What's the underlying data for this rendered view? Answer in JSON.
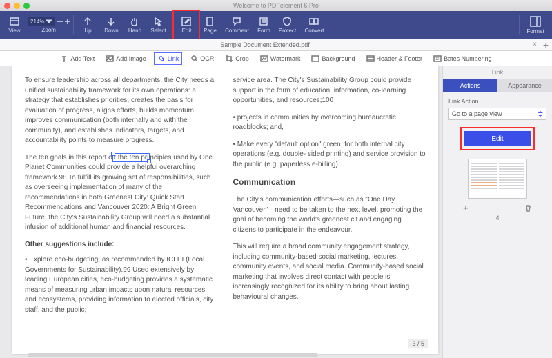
{
  "window": {
    "title": "Welcome to PDFelement 6 Pro"
  },
  "toolbar": {
    "view": "View",
    "zoom": "Zoom",
    "zoom_value": "214%",
    "up": "Up",
    "down": "Down",
    "hand": "Hand",
    "select": "Select",
    "edit": "Edit",
    "page": "Page",
    "comment": "Comment",
    "form": "Form",
    "protect": "Protect",
    "convert": "Convert",
    "format": "Format"
  },
  "tabs": {
    "doc": "Sample Document Extended.pdf",
    "close": "×",
    "plus": "+"
  },
  "subbar": {
    "add_text": "Add Text",
    "add_image": "Add Image",
    "link": "Link",
    "ocr": "OCR",
    "crop": "Crop",
    "watermark": "Watermark",
    "background": "Background",
    "header_footer": "Header & Footer",
    "bates": "Bates Numbering"
  },
  "doc": {
    "left": {
      "p1": "To ensure leadership across all departments, the City needs a unified sustainability framework for its own operations: a strategy that establishes priorities, creates the basis for evaluation of progress, aligns efforts, builds momentum, improves communication (both internally and with the community), and establishes indicators, targets, and accountability points to measure progress.",
      "p2a": "The ten goals in this report o",
      "p2_sel": "r the ten pri",
      "p2b": "nciples used by One Planet Communities could provide a helpful overarching framework.98 To fulfill its growing set of responsibilities, such as overseeing implementation of many of the recommendations in both Greenest City: Quick Start Recommendations and Vancouver 2020: A Bright Green Future, the City's Sustainability Group will need a substantial infusion of additional human and financial resources.",
      "sub": "Other suggestions include:",
      "p3": "• Explore eco-budgeting, as recommended by ICLEI (Local Governments for Sustainability).99 Used extensively by leading European cities, eco-budgeting provides a systematic means of measuring urban impacts upon natural resources and ecosystems, providing information to elected officials, city staff, and the public;"
    },
    "right": {
      "p1": "service area. The City's Sustainability Group could provide support in the form of education, information, co-learning opportunities, and resources;100",
      "p2": "• projects in communities by overcoming bureaucratic roadblocks; and,",
      "p3": "• Make every \"default option\" green, for both internal city operations (e.g. double- sided printing) and service provision to the public (e.g. paperless e-billing).",
      "h": "Communication",
      "p4": "The City's communication efforts—such as \"One Day Vancouver\"—need to be taken to the next level, promoting the goal of becoming the world's greenest cit and engaging citizens to participate in the endeavour.",
      "p5": "This will require a broad community engagement strategy, including community-based social marketing, lectures, community events, and social media. Community-based social marketing that involves direct contact with people is increasingly recognized for its ability to bring about lasting behavioural changes."
    },
    "page_indicator": "3 / 5"
  },
  "side": {
    "title": "Link",
    "tab_actions": "Actions",
    "tab_appearance": "Appearance",
    "section": "Link Action",
    "select_value": "Go to a page view",
    "edit_btn": "Edit",
    "thumb_plus": "+",
    "thumb_page": "4"
  }
}
